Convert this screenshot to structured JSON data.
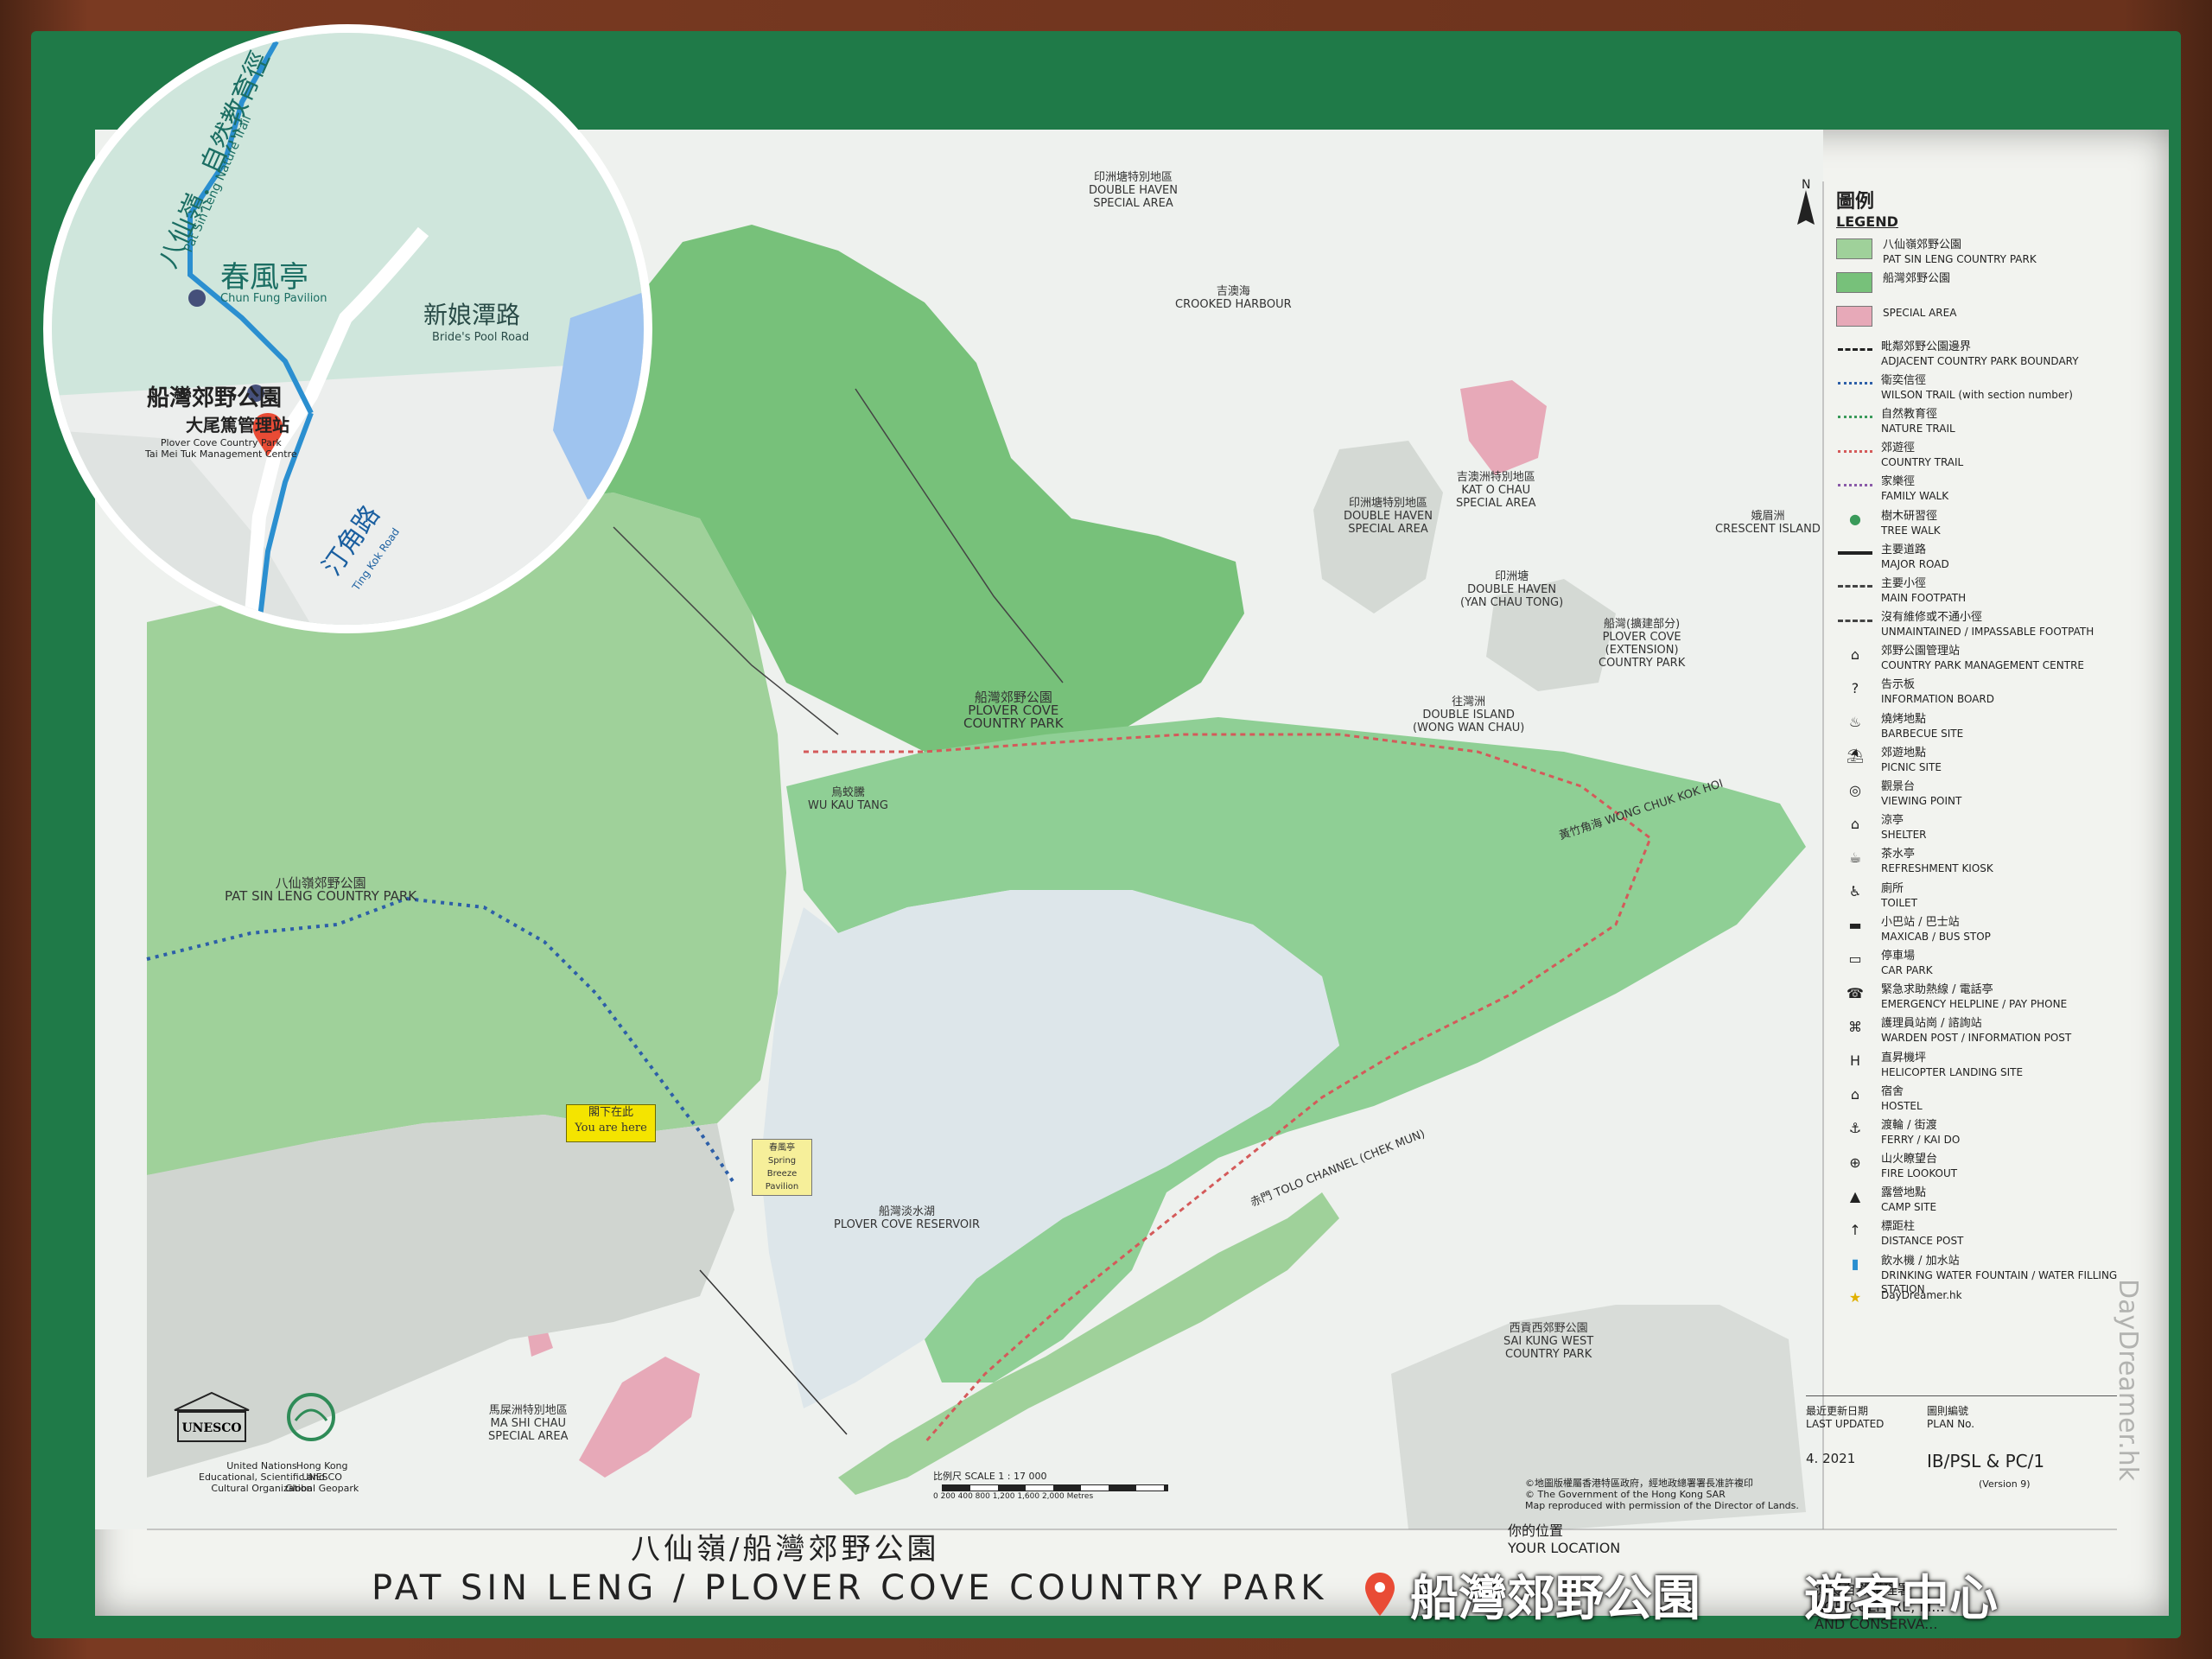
{
  "map": {
    "title_zh": "八仙嶺/船灣郊野公園",
    "title_en": "PAT SIN LENG / PLOVER COVE COUNTRY PARK",
    "you_are_here_zh": "閣下在此",
    "you_are_here_en": "You are here",
    "pavilion_label": "春風亭 Spring Breeze Pavilion",
    "scale_text": "比例尺 SCALE 1 : 17 000",
    "scale_ticks": "0  200  400  800  1,200  1,600  2,000 Metres",
    "labels": [
      {
        "id": "double-haven-top",
        "text": "印洲塘特別地區\nDOUBLE HAVEN\nSPECIAL AREA"
      },
      {
        "id": "crooked-harbour",
        "text": "吉澳海\nCROOKED HARBOUR"
      },
      {
        "id": "plover-cove-park",
        "text": "船灣郊野公園\nPLOVER COVE\nCOUNTRY PARK"
      },
      {
        "id": "pat-sin-leng-park",
        "text": "八仙嶺郊野公園\nPAT SIN LENG COUNTRY PARK"
      },
      {
        "id": "double-haven-mid",
        "text": "印洲塘特別地區\nDOUBLE HAVEN\nSPECIAL AREA"
      },
      {
        "id": "kat-o-chau",
        "text": "吉澳洲特別地區\nKAT O CHAU\nSPECIAL AREA"
      },
      {
        "id": "crescent-island",
        "text": "娥眉洲\nCRESCENT ISLAND"
      },
      {
        "id": "double-haven-water",
        "text": "印洲塘\nDOUBLE HAVEN\n(YAN CHAU TONG)"
      },
      {
        "id": "plover-cove-ext",
        "text": "船灣(擴建部分)\nPLOVER COVE\n(EXTENSION)\nCOUNTRY PARK"
      },
      {
        "id": "double-island",
        "text": "往灣洲\nDOUBLE ISLAND\n(WONG WAN CHAU)"
      },
      {
        "id": "wu-kau-tang",
        "text": "烏蛟騰\nWU KAU TANG"
      },
      {
        "id": "reservoir",
        "text": "船灣淡水湖\nPLOVER COVE RESERVOIR"
      },
      {
        "id": "tolo-channel",
        "text": "赤門 TOLO CHANNEL (CHEK MUN)"
      },
      {
        "id": "sai-kung-west",
        "text": "西貢西郊野公園\nSAI KUNG WEST\nCOUNTRY PARK"
      },
      {
        "id": "ma-shi-chau",
        "text": "馬屎洲特別地區\nMA SHI CHAU\nSPECIAL AREA"
      },
      {
        "id": "wong-chuk-kok-hoi",
        "text": "黃竹角海 WONG CHUK KOK HOI"
      }
    ]
  },
  "legend": {
    "heading_zh": "圖例",
    "heading_en": "LEGEND",
    "items": [
      {
        "zh": "八仙嶺郊野公園",
        "en": "PAT SIN LENG COUNTRY PARK",
        "symbol": "swatch",
        "color": "#9fd19a"
      },
      {
        "zh": "船灣郊野公園",
        "en": "",
        "symbol": "swatch",
        "color": "#77c17a"
      },
      {
        "zh": "",
        "en": "SPECIAL AREA",
        "symbol": "swatch",
        "color": "#e7a9b8"
      },
      {
        "zh": "毗鄰郊野公園邊界",
        "en": "ADJACENT COUNTRY PARK BOUNDARY",
        "symbol": "dash"
      },
      {
        "zh": "衛奕信徑",
        "en": "WILSON TRAIL (with section number)",
        "symbol": "dot-blue"
      },
      {
        "zh": "自然教育徑",
        "en": "NATURE TRAIL",
        "symbol": "dot-green"
      },
      {
        "zh": "郊遊徑",
        "en": "COUNTRY TRAIL",
        "symbol": "dot-red"
      },
      {
        "zh": "家樂徑",
        "en": "FAMILY WALK",
        "symbol": "dot-purple"
      },
      {
        "zh": "樹木研習徑",
        "en": "TREE WALK",
        "symbol": "tree-icon"
      },
      {
        "zh": "主要道路",
        "en": "MAJOR ROAD",
        "symbol": "road"
      },
      {
        "zh": "主要小徑",
        "en": "MAIN FOOTPATH",
        "symbol": "footpath"
      },
      {
        "zh": "沒有維修或不通小徑",
        "en": "UNMAINTAINED / IMPASSABLE FOOTPATH",
        "symbol": "dash-thin"
      },
      {
        "zh": "郊野公園管理站",
        "en": "COUNTRY PARK MANAGEMENT CENTRE",
        "symbol": "house-icon"
      },
      {
        "zh": "告示板",
        "en": "INFORMATION BOARD",
        "symbol": "question-icon"
      },
      {
        "zh": "燒烤地點",
        "en": "BARBECUE SITE",
        "symbol": "bbq-icon"
      },
      {
        "zh": "郊遊地點",
        "en": "PICNIC SITE",
        "symbol": "picnic-icon"
      },
      {
        "zh": "觀景台",
        "en": "VIEWING POINT",
        "symbol": "view-icon"
      },
      {
        "zh": "涼亭",
        "en": "SHELTER",
        "symbol": "shelter-icon"
      },
      {
        "zh": "茶水亭",
        "en": "REFRESHMENT KIOSK",
        "symbol": "kiosk-icon"
      },
      {
        "zh": "廁所",
        "en": "TOILET",
        "symbol": "toilet-icon"
      },
      {
        "zh": "小巴站 / 巴士站",
        "en": "MAXICAB / BUS STOP",
        "symbol": "bus-icon"
      },
      {
        "zh": "停車場",
        "en": "CAR PARK",
        "symbol": "car-icon"
      },
      {
        "zh": "緊急求助熱線 / 電話亭",
        "en": "EMERGENCY HELPLINE / PAY PHONE",
        "symbol": "phone-icon"
      },
      {
        "zh": "護理員站崗 / 諮詢站",
        "en": "WARDEN POST / INFORMATION POST",
        "symbol": "warden-icon"
      },
      {
        "zh": "直昇機坪",
        "en": "HELICOPTER LANDING SITE",
        "symbol": "heli-icon"
      },
      {
        "zh": "宿舍",
        "en": "HOSTEL",
        "symbol": "hostel-icon"
      },
      {
        "zh": "渡輪 / 街渡",
        "en": "FERRY / KAI DO",
        "symbol": "ferry-icon"
      },
      {
        "zh": "山火瞭望台",
        "en": "FIRE LOOKOUT",
        "symbol": "fire-icon"
      },
      {
        "zh": "露營地點",
        "en": "CAMP SITE",
        "symbol": "camp-icon"
      },
      {
        "zh": "標距柱",
        "en": "DISTANCE POST",
        "symbol": "post-icon"
      },
      {
        "zh": "飲水機 / 加水站",
        "en": "DRINKING WATER FOUNTAIN / WATER FILLING STATION",
        "symbol": "water-icon"
      },
      {
        "zh": "",
        "en": "DayDreamer.hk",
        "symbol": "daydreamer-icon"
      }
    ]
  },
  "info": {
    "last_updated_label": "最近更新日期\nLAST UPDATED",
    "last_updated_value": "4. 2021",
    "plan_no_label": "圖則編號\nPLAN No.",
    "plan_no_value": "IB/PSL & PC/1",
    "version": "(Version 9)",
    "your_location": "你的位置\nYOUR LOCATION",
    "afcd": "漁農自然護理署\nAGRICULTURE, FI...\nAND CONSERVA...",
    "copyright": "©地圖版權屬香港特區政府，經地政總署署長准許複印\n© The Government of the Hong Kong SAR\nMap reproduced with permission of the Director of Lands."
  },
  "logos": {
    "unesco_text": "United Nations\nEducational, Scientific and\nCultural Organization",
    "geopark_text": "Hong Kong\nUNESCO\nGlobal Geopark",
    "unesco_mark": "UNESCO"
  },
  "inset": {
    "trail_label": "八仙嶺．自然教育徑",
    "trail_label_en": "Pat Sin Leng Nature Trail",
    "pavilion_zh": "春風亭",
    "pavilion_en": "Chun Fung Pavilion",
    "road_zh": "新娘潭路",
    "road_en": "Bride's Pool Road",
    "centre_zh": "船灣郊野公園",
    "centre_zh2": "大尾篤管理站",
    "centre_en": "Plover Cove Country Park\nTai Mei Tuk Management Centre",
    "ting_kok_zh": "汀角路",
    "ting_kok_en": "Ting Kok Road"
  },
  "overlay": {
    "left": "船灣郊野公園",
    "right": "遊客中心"
  },
  "watermark": "DayDreamer.hk",
  "colors": {
    "park_green": "#9fd19a",
    "park_green_dark": "#77c17a",
    "special_area": "#e7a9b8",
    "water": "#e9efee",
    "trail_red": "#d45a5a",
    "trail_blue": "#2d5fa8"
  }
}
